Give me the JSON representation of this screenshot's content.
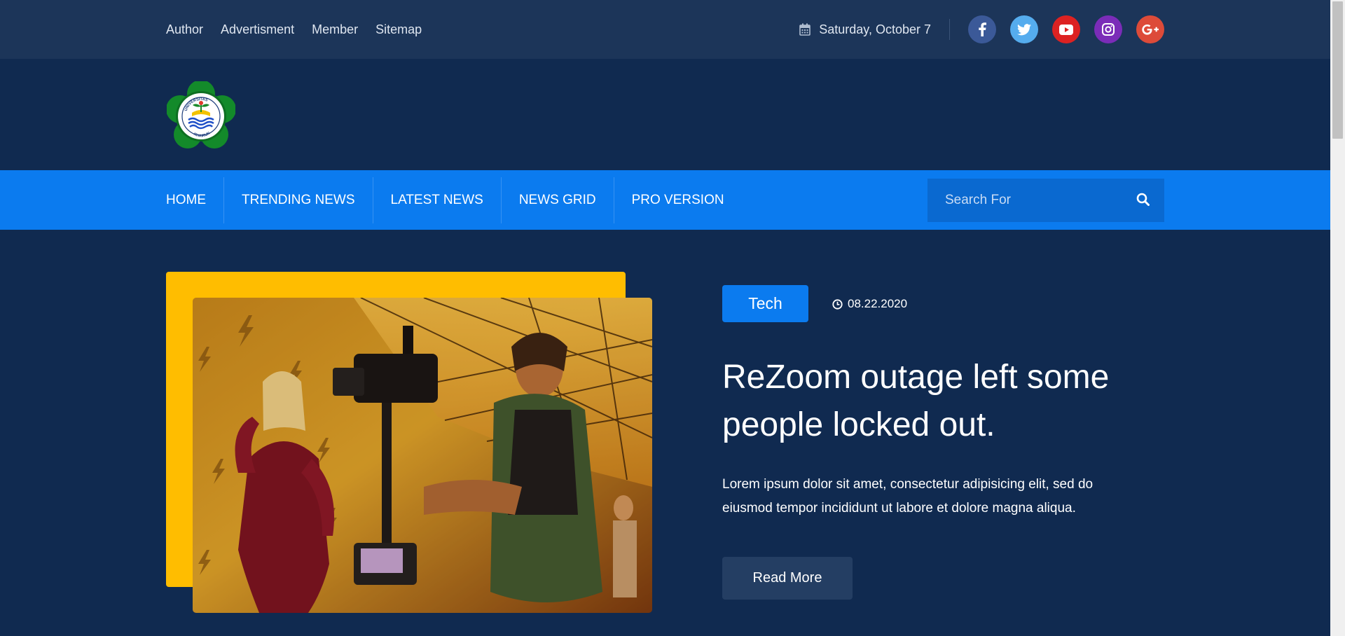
{
  "topbar": {
    "links": [
      "Author",
      "Advertisment",
      "Member",
      "Sitemap"
    ],
    "date": "Saturday, October 7",
    "date_icon": "calendar-icon",
    "socials": [
      {
        "name": "facebook",
        "icon": "facebook-icon",
        "color": "#3b5998"
      },
      {
        "name": "twitter",
        "icon": "twitter-icon",
        "color": "#55acee"
      },
      {
        "name": "youtube",
        "icon": "youtube-icon",
        "color": "#dd2222"
      },
      {
        "name": "instagram",
        "icon": "instagram-icon",
        "color": "#7b2cb8"
      },
      {
        "name": "google-plus",
        "icon": "google-plus-icon",
        "color": "#dd4b39"
      }
    ]
  },
  "header": {
    "logo": {
      "icon": "university-seal-logo",
      "text_top": "UNIVERSITAS",
      "text_bottom": "KHAIRUN"
    }
  },
  "nav": {
    "items": [
      "HOME",
      "TRENDING NEWS",
      "LATEST NEWS",
      "NEWS GRID",
      "PRO VERSION"
    ],
    "search_placeholder": "Search For",
    "search_icon": "search-icon"
  },
  "hero": {
    "category": "Tech",
    "date": "08.22.2020",
    "date_icon": "clock-icon",
    "title": "ReZoom outage left some people locked out.",
    "excerpt": "Lorem ipsum dolor sit amet, consectetur adipisicing elit, sed do eiusmod tempor incididunt ut labore et dolore magna aliqua.",
    "read_more": "Read More",
    "image": "film-crew-camera-photo"
  },
  "colors": {
    "topbar_bg": "#1c3559",
    "page_bg": "#102a50",
    "nav_bg": "#0b7bef",
    "accent_yellow": "#ffbd00",
    "button_dark": "#243e63"
  }
}
